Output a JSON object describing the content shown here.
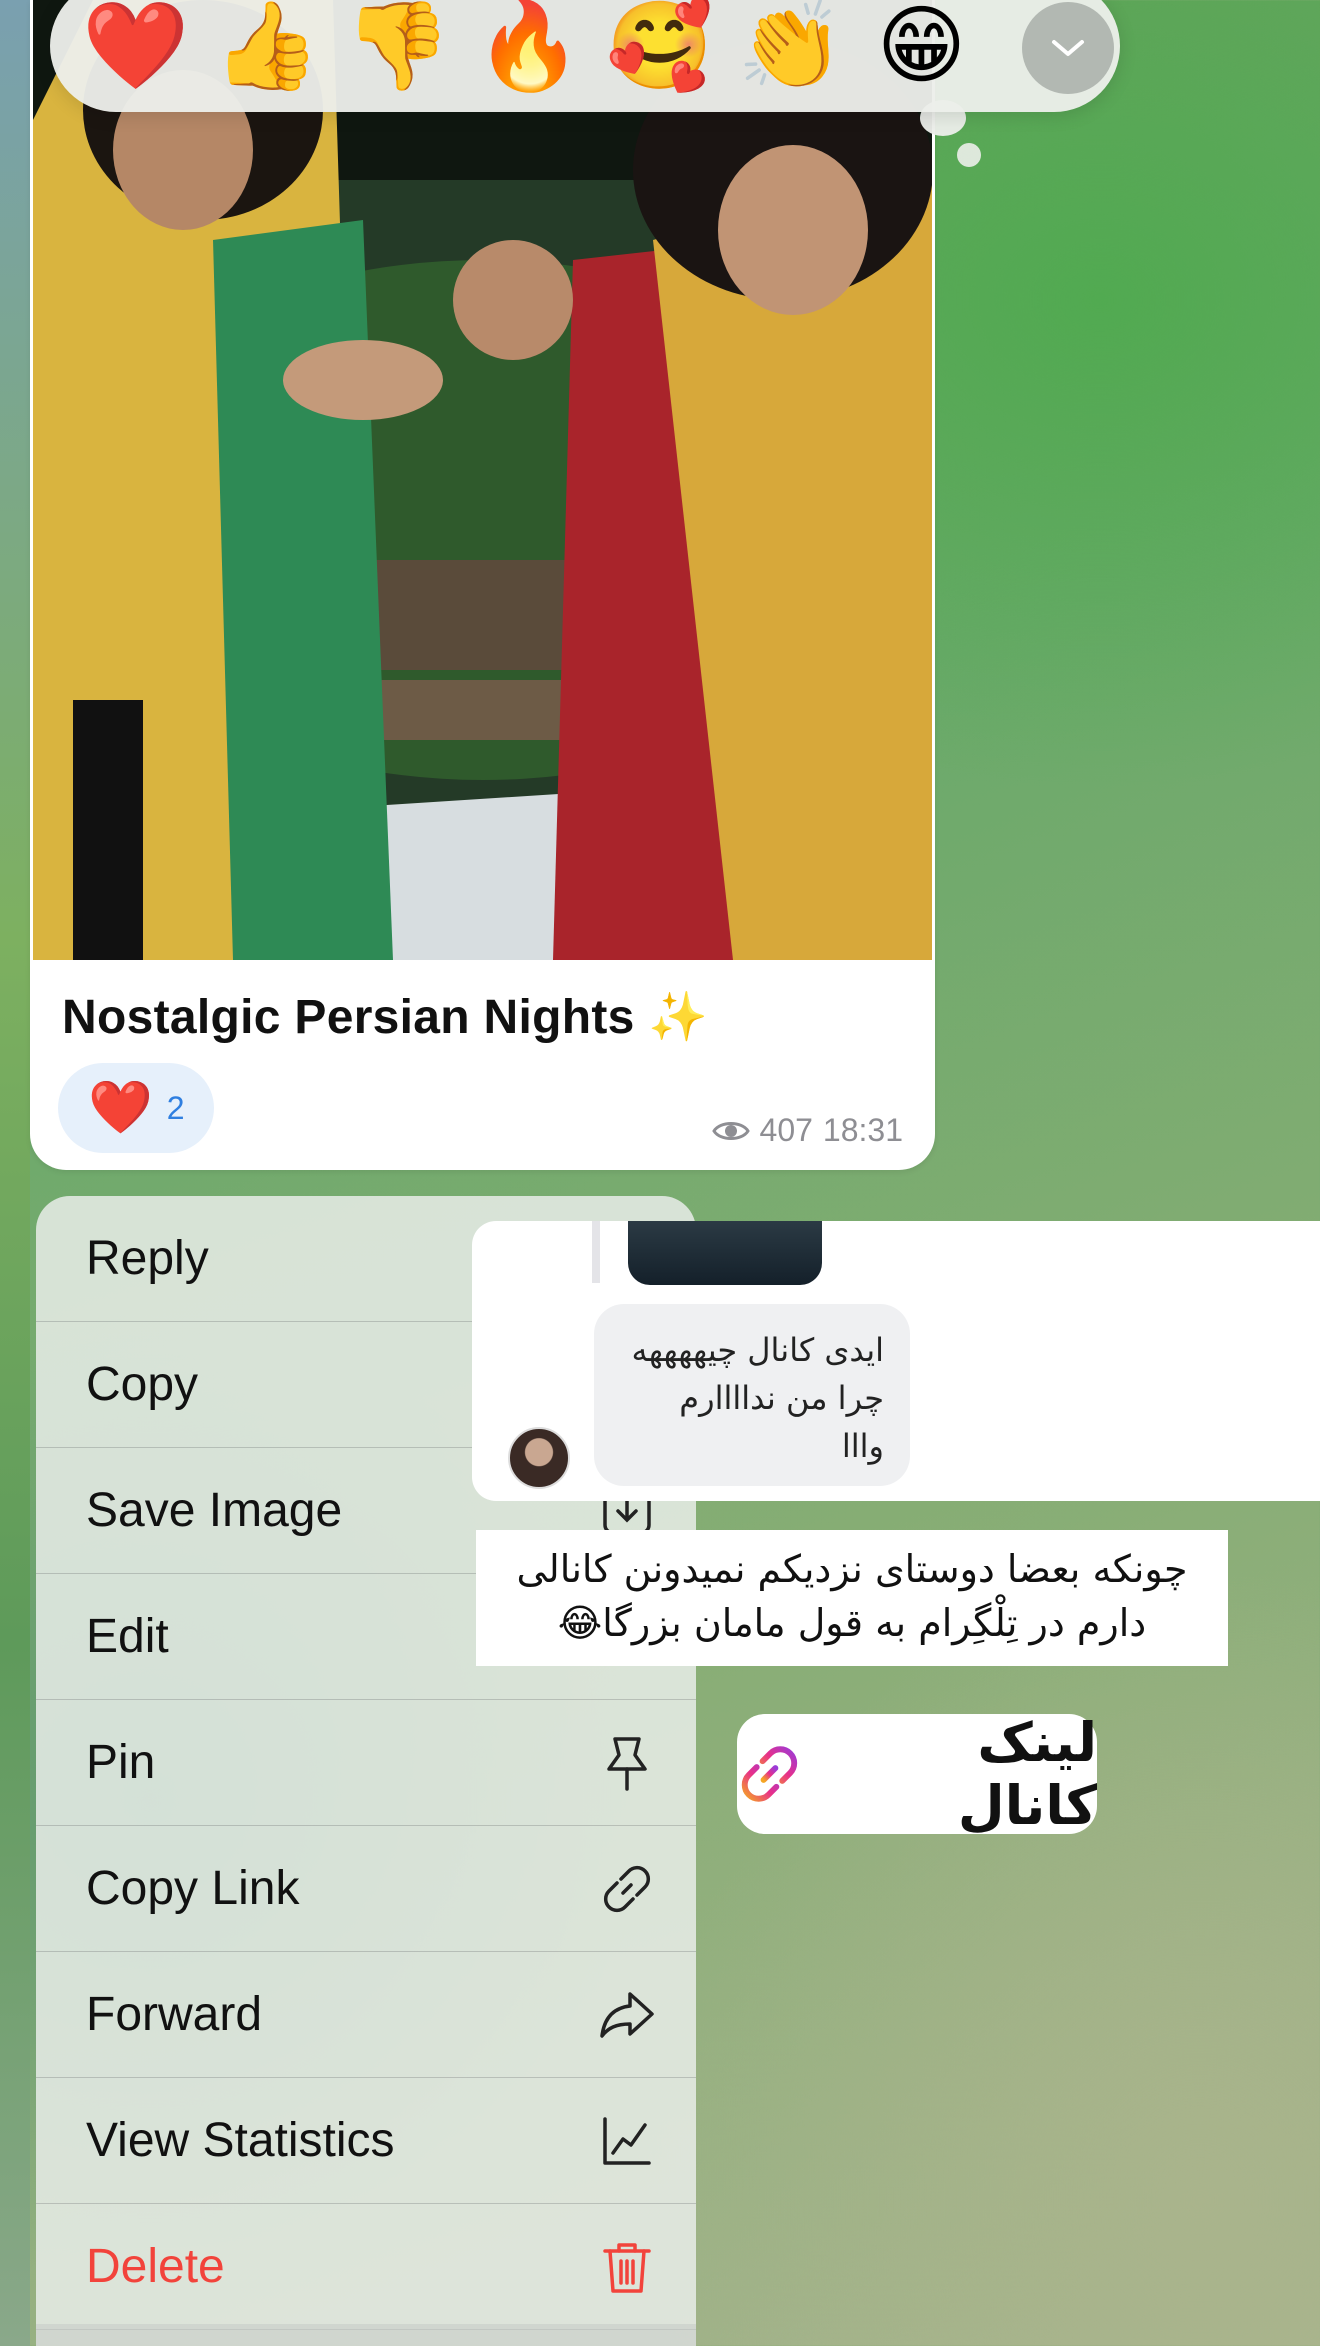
{
  "reactions": {
    "emojis": [
      "❤️",
      "👍",
      "👎",
      "🔥",
      "🥰",
      "👏",
      "😁"
    ],
    "expand_icon": "chevron-down-icon"
  },
  "message": {
    "caption": "Nostalgic Persian Nights ✨",
    "reaction": {
      "emoji": "❤️",
      "count": "2"
    },
    "views": "407",
    "time": "18:31"
  },
  "menu": {
    "items": [
      {
        "label": "Reply",
        "icon": "reply-icon"
      },
      {
        "label": "Copy",
        "icon": "copy-icon"
      },
      {
        "label": "Save Image",
        "icon": "save-image-icon"
      },
      {
        "label": "Edit",
        "icon": "edit-icon"
      },
      {
        "label": "Pin",
        "icon": "pin-icon"
      },
      {
        "label": "Copy Link",
        "icon": "link-icon"
      },
      {
        "label": "Forward",
        "icon": "forward-icon"
      },
      {
        "label": "View Statistics",
        "icon": "statistics-icon"
      },
      {
        "label": "Delete",
        "icon": "trash-icon"
      }
    ],
    "danger_color": "#f2433b"
  },
  "overlay": {
    "comment_lines": [
      "ایدی کانال چیههههه",
      "چرا من نداااارم",
      "وااا"
    ],
    "note_lines": [
      "چونکه بعضا دوستای نزدیکم نمیدونن کانالی",
      "دارم در تِلْگِرام به قول مامان بزرگا😂"
    ],
    "link_label": "لینک کانال"
  }
}
